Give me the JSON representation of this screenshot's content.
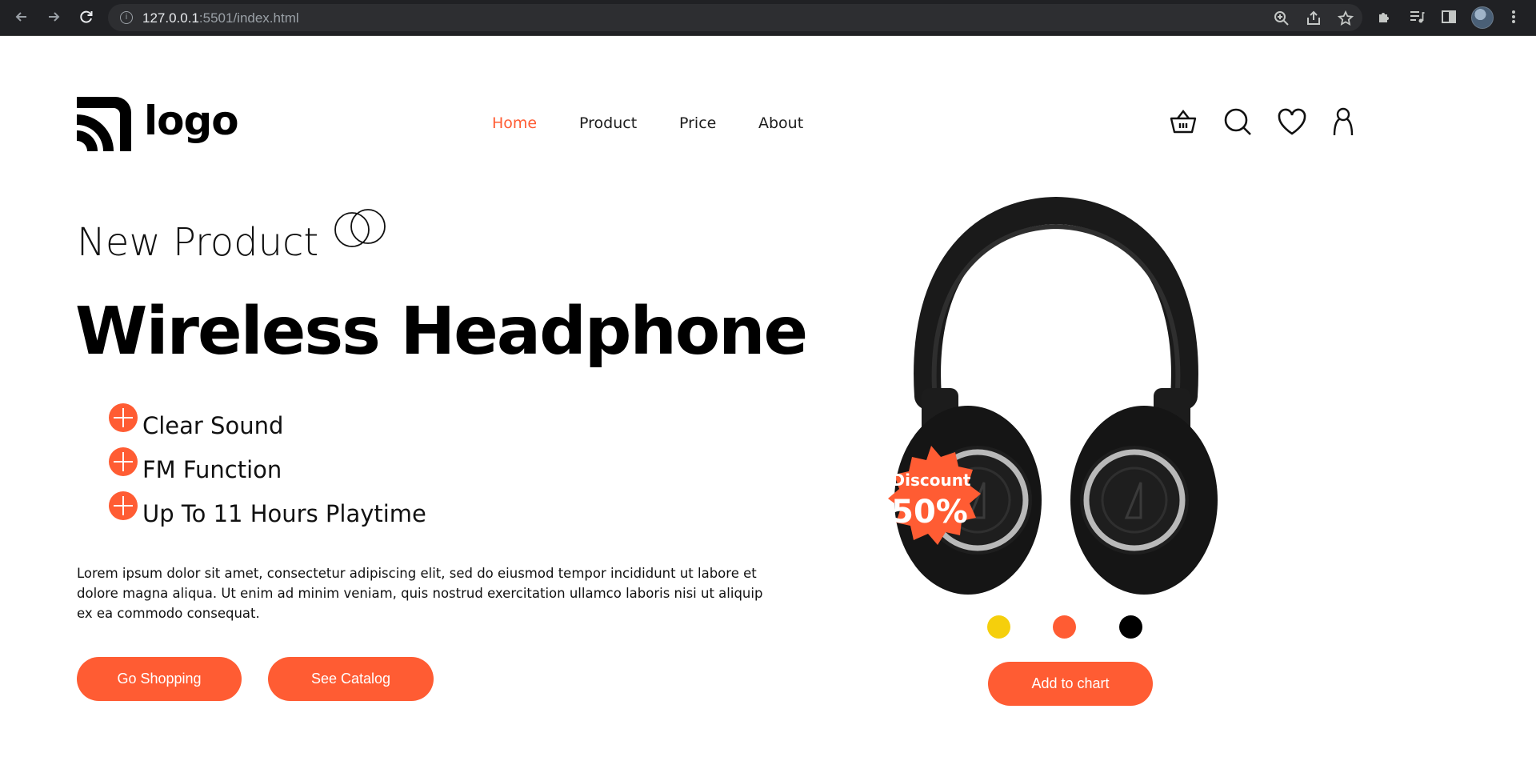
{
  "browser": {
    "url_host": "127.0.0.1",
    "url_rest": ":5501/index.html"
  },
  "brand": {
    "logo_text": "logo"
  },
  "nav": {
    "items": [
      {
        "label": "Home",
        "active": true
      },
      {
        "label": "Product",
        "active": false
      },
      {
        "label": "Price",
        "active": false
      },
      {
        "label": "About",
        "active": false
      }
    ]
  },
  "header_icons": [
    "basket-icon",
    "search-icon",
    "heart-icon",
    "user-icon"
  ],
  "hero": {
    "eyebrow": "New Product",
    "title": "Wireless Headphone",
    "features": [
      "Clear Sound",
      "FM Function",
      "Up To 11 Hours Playtime"
    ],
    "description": "Lorem ipsum dolor sit amet, consectetur adipiscing elit, sed do eiusmod tempor incididunt ut labore et dolore magna aliqua. Ut enim ad minim veniam, quis nostrud exercitation ullamco laboris nisi ut aliquip ex ea commodo consequat.",
    "primary_button": "Go Shopping",
    "secondary_button": "See Catalog"
  },
  "product": {
    "badge_label": "Discount",
    "badge_value": "50%",
    "color_options": [
      "#f5cf0c",
      "#ff5c33",
      "#000000"
    ],
    "cta": "Add to chart"
  },
  "colors": {
    "accent": "#ff5c33",
    "text": "#000000",
    "chrome_bg": "#202124"
  }
}
